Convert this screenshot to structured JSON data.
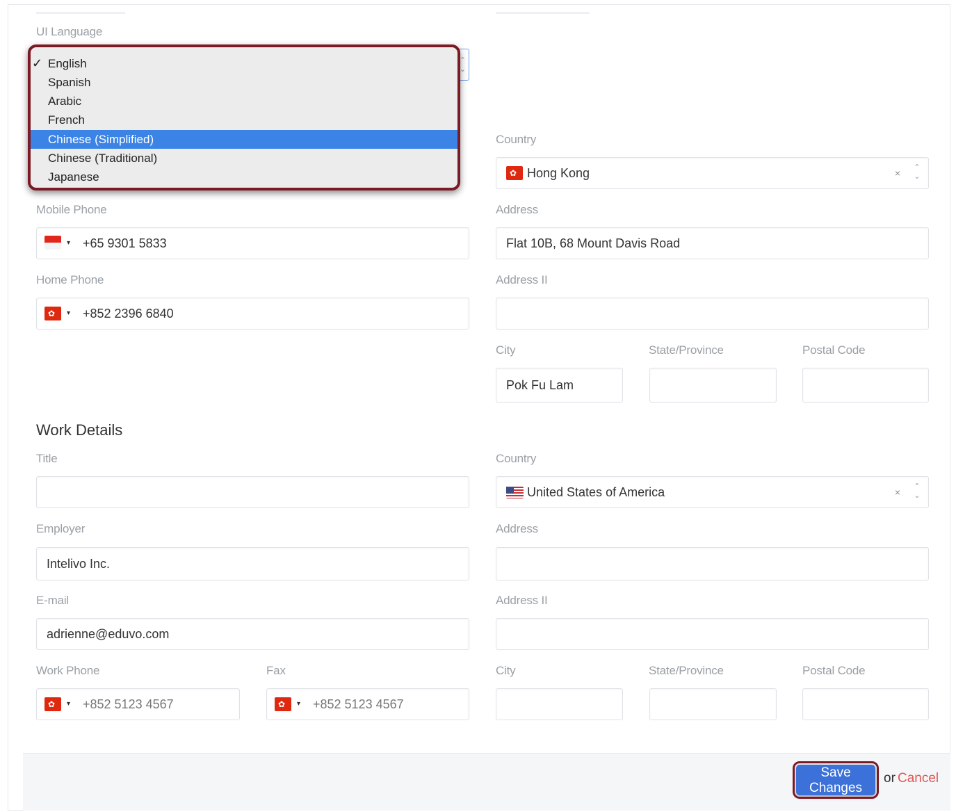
{
  "ui_language": {
    "label": "UI Language",
    "options": [
      {
        "label": "English",
        "checked": true
      },
      {
        "label": "Spanish"
      },
      {
        "label": "Arabic"
      },
      {
        "label": "French"
      },
      {
        "label": "Chinese (Simplified)",
        "highlighted": true
      },
      {
        "label": "Chinese (Traditional)"
      },
      {
        "label": "Japanese"
      }
    ],
    "checkmark": "✓"
  },
  "personal": {
    "mobile_phone": {
      "label": "Mobile Phone",
      "flag": "sg-flag-icon",
      "value": "+65 9301 5833"
    },
    "home_phone": {
      "label": "Home Phone",
      "flag": "hk-flag-icon",
      "value": "+852 2396 6840"
    },
    "country": {
      "label": "Country",
      "flag": "hk-flag-icon",
      "value": "Hong Kong"
    },
    "address": {
      "label": "Address",
      "value": "Flat 10B, 68 Mount Davis Road"
    },
    "address2": {
      "label": "Address II",
      "value": ""
    },
    "city": {
      "label": "City",
      "value": "Pok Fu Lam"
    },
    "state": {
      "label": "State/Province",
      "value": ""
    },
    "postal": {
      "label": "Postal Code",
      "value": ""
    }
  },
  "work": {
    "heading": "Work Details",
    "title": {
      "label": "Title",
      "value": ""
    },
    "employer": {
      "label": "Employer",
      "value": "Intelivo Inc."
    },
    "email": {
      "label": "E-mail",
      "value": "adrienne@eduvo.com"
    },
    "work_phone": {
      "label": "Work Phone",
      "flag": "hk-flag-icon",
      "placeholder": "+852 5123 4567"
    },
    "fax": {
      "label": "Fax",
      "flag": "hk-flag-icon",
      "placeholder": "+852 5123 4567"
    },
    "country": {
      "label": "Country",
      "flag": "us-flag-icon",
      "value": "United States of America"
    },
    "address": {
      "label": "Address",
      "value": ""
    },
    "address2": {
      "label": "Address II",
      "value": ""
    },
    "city": {
      "label": "City",
      "value": ""
    },
    "state": {
      "label": "State/Province",
      "value": ""
    },
    "postal": {
      "label": "Postal Code",
      "value": ""
    }
  },
  "footer": {
    "save_label": "Save Changes",
    "or_text": "or",
    "cancel_label": "Cancel"
  },
  "glyphs": {
    "caret": "▾",
    "clear": "×",
    "up": "⌃",
    "down": "⌄"
  },
  "colors": {
    "primary": "#3b71d9",
    "highlight": "#3b84e6",
    "annotation": "#7b1a24",
    "cancel": "#e25656"
  }
}
